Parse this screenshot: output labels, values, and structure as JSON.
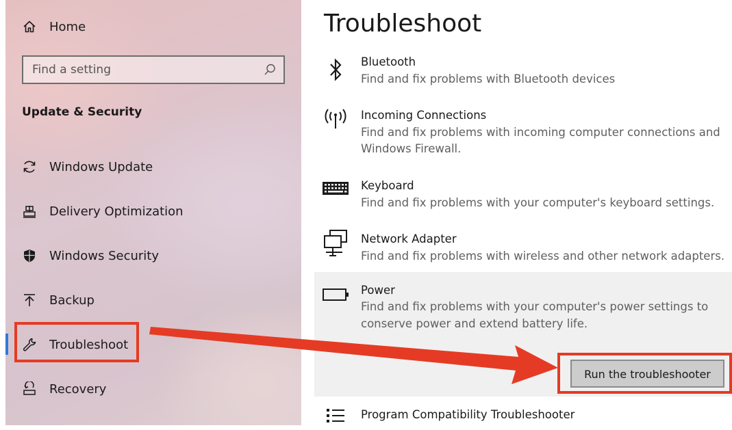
{
  "sidebar": {
    "home_label": "Home",
    "search_placeholder": "Find a setting",
    "section_title": "Update & Security",
    "items": [
      {
        "label": "Windows Update",
        "icon": "sync-icon"
      },
      {
        "label": "Delivery Optimization",
        "icon": "delivery-optimization-icon"
      },
      {
        "label": "Windows Security",
        "icon": "shield-icon"
      },
      {
        "label": "Backup",
        "icon": "backup-arrow-icon"
      },
      {
        "label": "Troubleshoot",
        "icon": "wrench-icon",
        "selected": true
      },
      {
        "label": "Recovery",
        "icon": "recovery-icon"
      }
    ]
  },
  "main": {
    "title": "Troubleshoot",
    "items": [
      {
        "title": "Bluetooth",
        "desc": "Find and fix problems with Bluetooth devices",
        "icon": "bluetooth-icon"
      },
      {
        "title": "Incoming Connections",
        "desc_lines": [
          "Find and fix problems with incoming computer connections and",
          "Windows Firewall."
        ],
        "icon": "antenna-icon"
      },
      {
        "title": "Keyboard",
        "desc": "Find and fix problems with your computer's keyboard settings.",
        "icon": "keyboard-icon"
      },
      {
        "title": "Network Adapter",
        "desc": "Find and fix problems with wireless and other network adapters.",
        "icon": "network-adapter-icon"
      },
      {
        "title": "Power",
        "desc_lines": [
          "Find and fix problems with your computer's power settings to",
          "conserve power and extend battery life."
        ],
        "icon": "battery-icon",
        "expanded": true
      },
      {
        "title": "Program Compatibility Troubleshooter",
        "icon": "list-icon"
      }
    ],
    "run_button_label": "Run the troubleshooter"
  },
  "colors": {
    "annotation": "#e53b24",
    "selection_accent": "#2b79d6",
    "expanded_panel": "#f0f0f0",
    "button_bg": "#cccccc"
  }
}
